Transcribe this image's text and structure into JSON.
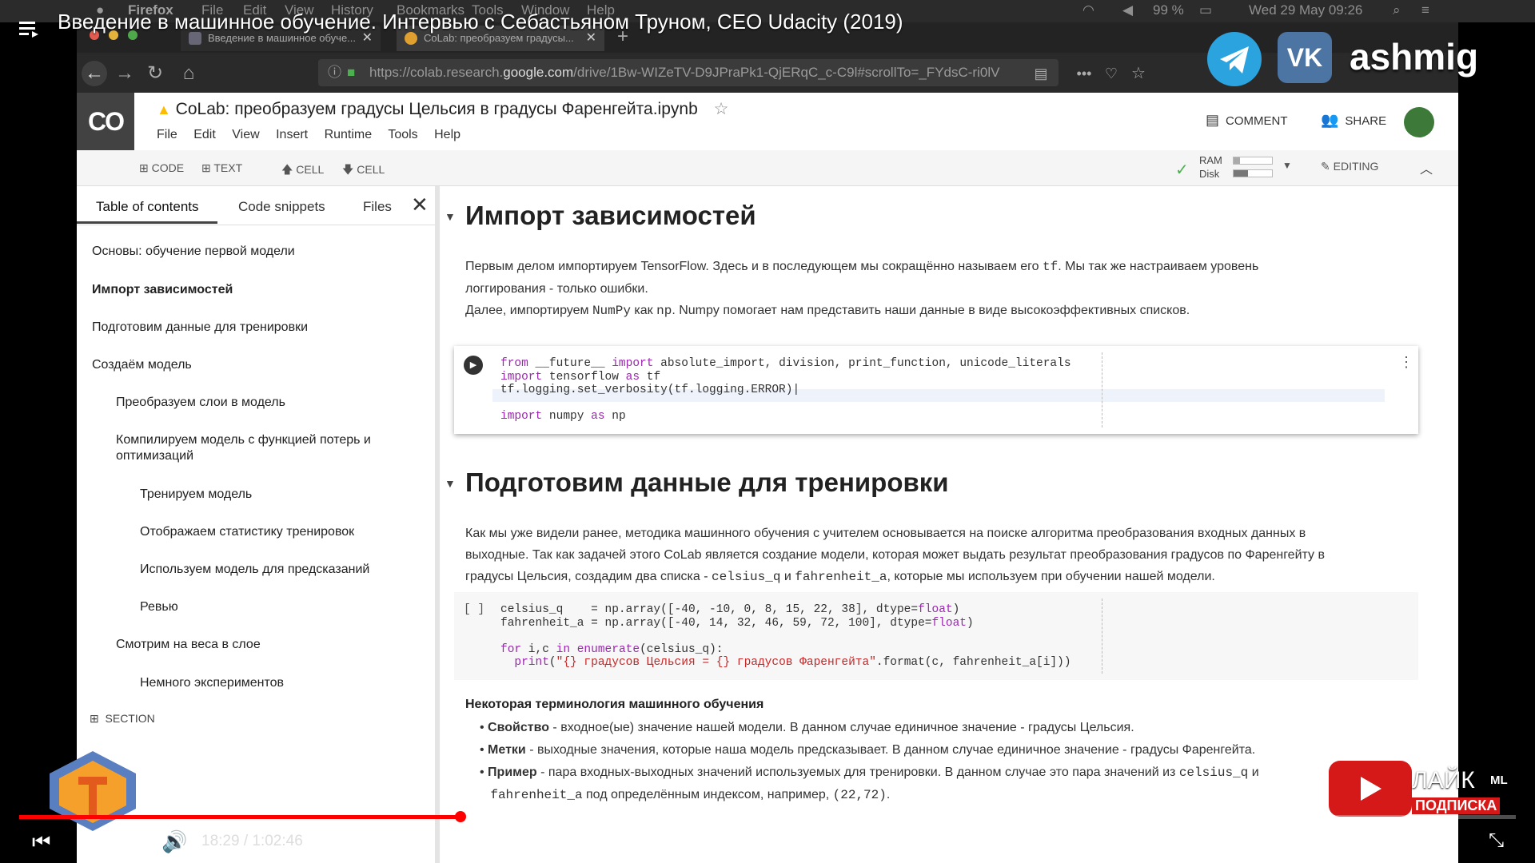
{
  "video": {
    "title": "Введение в машинное обучение. Интервью с Себастьяном Труном, CEO Udacity (2019)",
    "time_current": "18:29",
    "time_separator": "/",
    "time_total": "1:02:46",
    "progress_fraction": 0.295,
    "channel_watermark": "ashmig",
    "subscribe_like": "ЛАЙК",
    "subscribe_label": "ПОДПИСКА",
    "ml_badge": "ML"
  },
  "macos": {
    "app": "Firefox",
    "menu": [
      "File",
      "Edit",
      "View",
      "History",
      "Bookmarks",
      "Tools",
      "Window",
      "Help"
    ],
    "battery": "99 %",
    "datetime": "Wed 29 May  09:26"
  },
  "browser": {
    "tabs": [
      {
        "label": "Введение в машинное обуче..."
      },
      {
        "label": "CoLab: преобразуем градусы..."
      }
    ],
    "url_prefix": "https://colab.research.",
    "url_domain": "google.com",
    "url_rest": "/drive/1Bw-WIZeTV-D9JPraPk1-QjERqC_c-C9l#scrollTo=_FYdsC-ri0lV"
  },
  "colab": {
    "logo": "CO",
    "notebook_title": "CoLab: преобразуем градусы Цельсия в градусы Фаренгейта.ipynb",
    "menu": [
      "File",
      "Edit",
      "View",
      "Insert",
      "Runtime",
      "Tools",
      "Help"
    ],
    "comment": "COMMENT",
    "share": "SHARE",
    "toolbar": {
      "code": "CODE",
      "text": "TEXT",
      "cell_up": "CELL",
      "cell_down": "CELL",
      "ram": "RAM",
      "disk": "Disk",
      "editing": "EDITING"
    }
  },
  "sidebar": {
    "tabs": [
      "Table of contents",
      "Code snippets",
      "Files"
    ],
    "toc": [
      "Основы: обучение первой модели",
      "Импорт зависимостей",
      "Подготовим данные для тренировки",
      "Создаём модель",
      "Преобразуем слои в модель",
      "Компилируем модель с функцией потерь и",
      "оптимизаций",
      "Тренируем модель",
      "Отображаем статистику тренировок",
      "Используем модель для предсказаний",
      "Ревью",
      "Смотрим на веса в слое",
      "Немного экспериментов"
    ],
    "section": "SECTION"
  },
  "main": {
    "s1_title": "Импорт зависимостей",
    "s1_p1a": "Первым делом импортируем TensorFlow. Здесь и в последующем мы сокращённо называем его ",
    "s1_p1code": "tf",
    "s1_p1b": ". Мы так же настраиваем уровень",
    "s1_p1c": "логгирования - только ошибки.",
    "s1_p2a": "Далее, импортируем ",
    "s1_p2code1": "NumPy",
    "s1_p2b": " как ",
    "s1_p2code2": "np",
    "s1_p2c": ". Numpy помогает нам представить наши данные в виде высокоэффективных списков.",
    "s2_title": "Подготовим данные для тренировки",
    "s2_l1": "Как мы уже видели ранее, методика машинного обучения с учителем основывается на поиске алгоритма преобразования входных данных в",
    "s2_l2": "выходные. Так как задачей этого CoLab является создание модели, которая может выдать результат преобразования градусов по Фаренгейту в",
    "s2_l3a": "градусы Цельсия, создадим два списка - ",
    "s2_l3code1": "celsius_q",
    "s2_l3b": " и ",
    "s2_l3code2": "fahrenheit_a",
    "s2_l3c": ", которые мы используем при обучении нашей модели.",
    "cell2_prompt": "[ ]",
    "terms_title": "Некоторая терминология машинного обучения",
    "b1_bold": "Свойство",
    "b1_text": " - входное(ые) значение нашей модели. В данном случае единичное значение - градусы Цельсия.",
    "b2_bold": "Метки",
    "b2_text": " - выходные значения, которые наша модель предсказывает. В данном случае единичное значение - градусы Фаренгейта.",
    "b3_bold": "Пример",
    "b3_text": " - пара входных-выходных значений используемых для тренировки. В данном случае это пара значений из ",
    "b3_code1": "celsius_q",
    "b3_text2": " и",
    "b3_code2": "fahrenheit_a",
    "b3_text3": " под определённым индексом, например, ",
    "b3_code3": "(22,72)",
    "b3_text4": "."
  }
}
